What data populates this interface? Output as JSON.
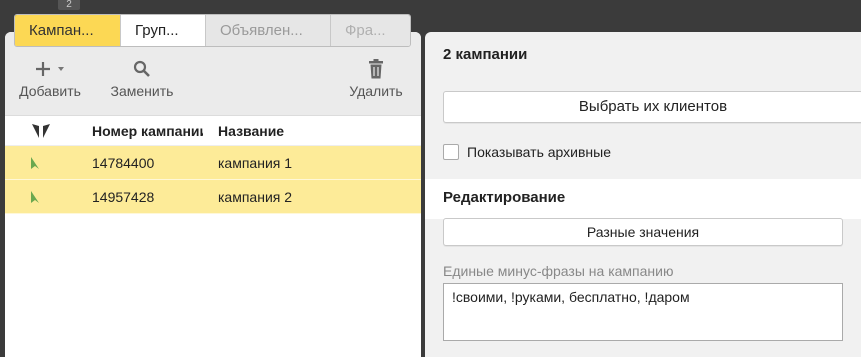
{
  "top_badge": "2",
  "tabs": [
    {
      "label": "Кампан..."
    },
    {
      "label": "Груп..."
    },
    {
      "label": "Объявлен..."
    },
    {
      "label": "Фра..."
    }
  ],
  "toolbar": {
    "add_label": "Добавить",
    "replace_label": "Заменить",
    "delete_label": "Удалить"
  },
  "grid": {
    "headers": {
      "number": "Номер кампании",
      "name": "Название"
    },
    "rows": [
      {
        "number": "14784400",
        "name": "кампания 1"
      },
      {
        "number": "14957428",
        "name": "кампания 2"
      }
    ]
  },
  "details": {
    "title": "2 кампании",
    "choose_clients_label": "Выбрать их клиентов",
    "show_archived_label": "Показывать архивные",
    "editing_title": "Редактирование",
    "different_values_label": "Разные значения",
    "minus_phrases_label": "Единые минус-фразы на кампанию",
    "minus_phrases_value": "!своими, !руками, бесплатно, !даром"
  },
  "colors": {
    "selected_row": "#fdeb98",
    "active_tab": "#fcd854",
    "campaign_icon": "#6aa84f"
  }
}
